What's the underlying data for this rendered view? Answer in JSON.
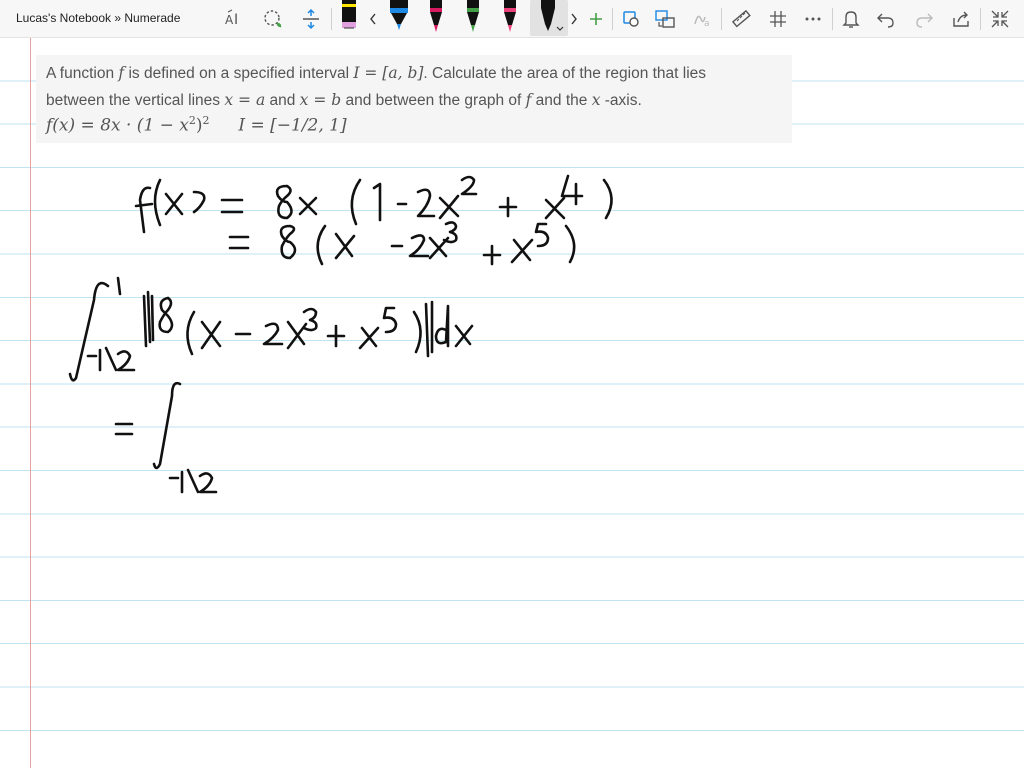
{
  "window": {
    "title": "Lucas's Notebook » Numerade"
  },
  "colors": {
    "pen_black": "#111111",
    "pen_blue": "#1e88e5",
    "pen_magenta": "#d81b60",
    "pen_green": "#43a047",
    "pen_pink": "#ec407a",
    "highlighter_yellow": "#ffe600",
    "accent": "#0a7bd3"
  },
  "toolbar": {
    "tools": [
      {
        "name": "text-tool-icon"
      },
      {
        "name": "lasso-select-icon"
      },
      {
        "name": "insert-space-icon"
      },
      {
        "name": "pen-black-icon"
      },
      {
        "name": "prev-pens-icon"
      },
      {
        "name": "pen-blue-icon"
      },
      {
        "name": "pen-magenta-icon"
      },
      {
        "name": "pen-green-icon"
      },
      {
        "name": "pen-pink-icon"
      },
      {
        "name": "pen-black-selected-icon"
      },
      {
        "name": "next-pens-icon"
      },
      {
        "name": "add-pen-icon"
      },
      {
        "name": "ink-to-shape-icon"
      },
      {
        "name": "ink-to-text-icon"
      },
      {
        "name": "ink-to-math-icon"
      },
      {
        "name": "ruler-icon"
      },
      {
        "name": "grid-icon"
      },
      {
        "name": "more-icon"
      },
      {
        "name": "notifications-icon"
      },
      {
        "name": "undo-icon"
      },
      {
        "name": "redo-icon"
      },
      {
        "name": "share-icon"
      },
      {
        "name": "fullscreen-icon"
      }
    ]
  },
  "problem": {
    "sentence1_part1": "A function ",
    "sentence1_f": "f",
    "sentence1_part2": " is defined on a specified interval ",
    "sentence1_interval": "I = [a, b]",
    "sentence1_part3": ". Calculate the area of the region that lies",
    "sentence2_part1": "between the vertical lines ",
    "sentence2_xa": "x = a",
    "sentence2_and": " and ",
    "sentence2_xb": "x = b",
    "sentence2_part2": " and between the graph of ",
    "sentence2_f": "f",
    "sentence2_part3": " and the ",
    "sentence2_x": "x",
    "sentence2_part4": " -axis.",
    "formula_lhs": "f(x) = 8x · (1 − x",
    "formula_exp_inner": "2",
    "formula_close": ")",
    "formula_exp_outer": "2",
    "formula_interval": "I = [−1/2, 1]"
  }
}
